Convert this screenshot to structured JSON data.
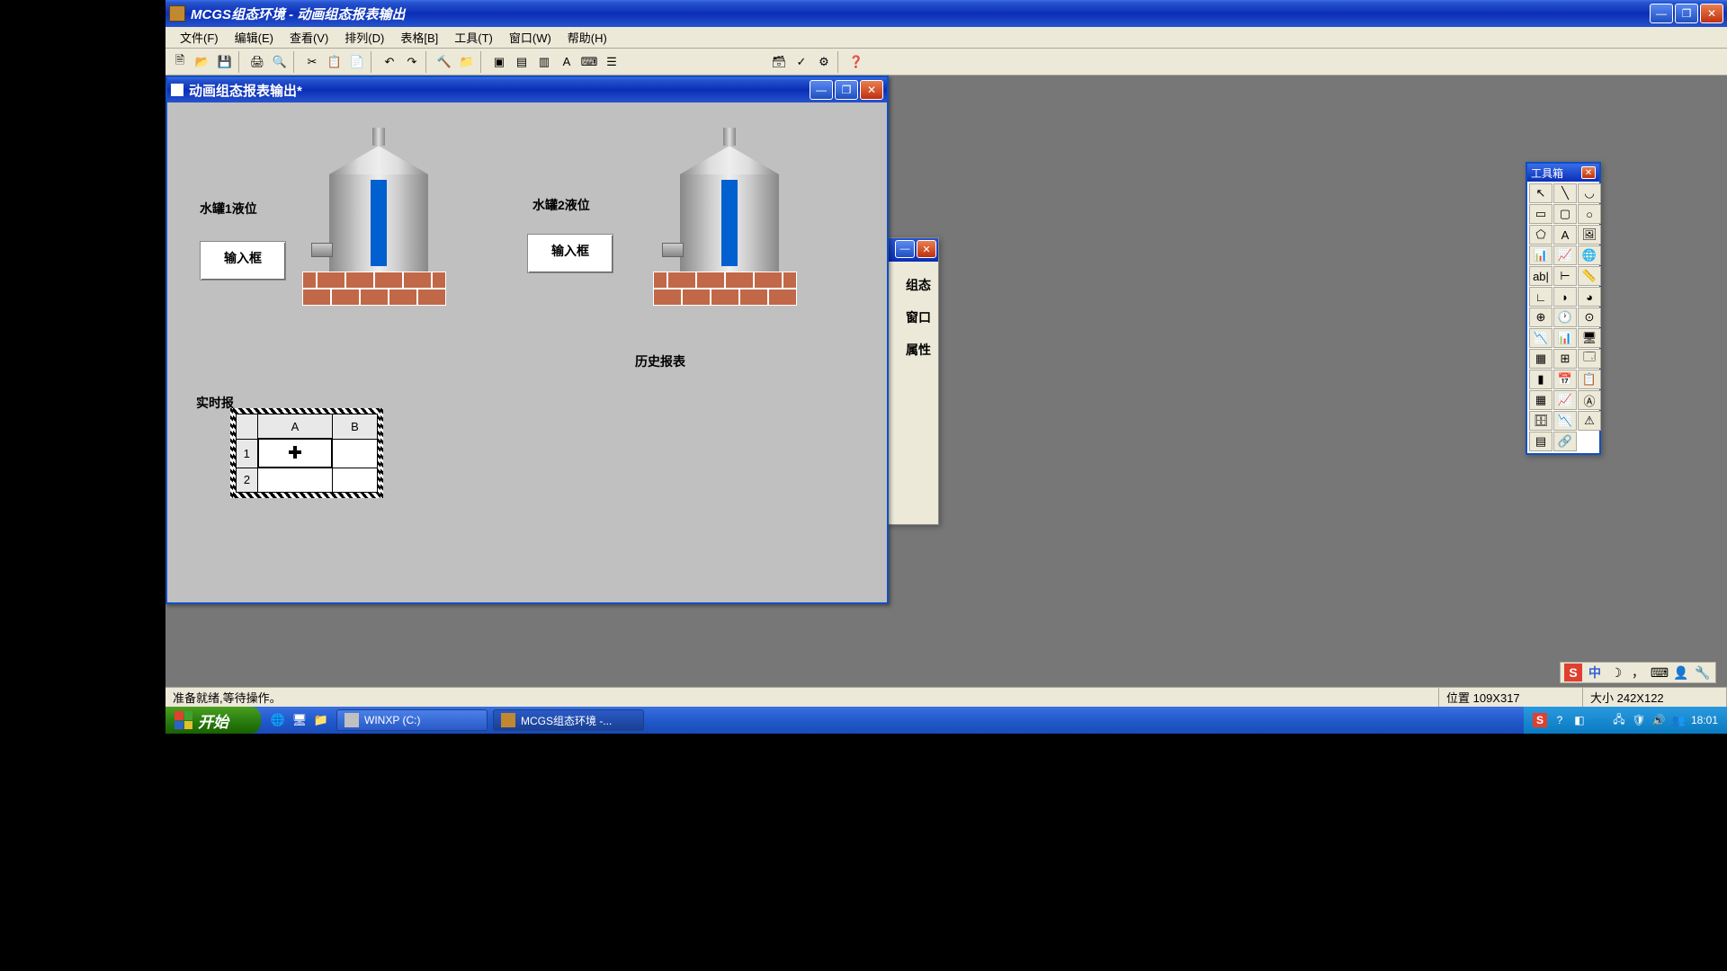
{
  "app": {
    "title": "MCGS组态环境 - 动画组态报表输出"
  },
  "menu": {
    "file": "文件(F)",
    "edit": "编辑(E)",
    "view": "查看(V)",
    "arrange": "排列(D)",
    "table": "表格[B]",
    "tools": "工具(T)",
    "window": "窗口(W)",
    "help": "帮助(H)"
  },
  "child": {
    "title": "动画组态报表输出*"
  },
  "canvas": {
    "tank1_label": "水罐1液位",
    "tank2_label": "水罐2液位",
    "input_box_label": "输入框",
    "history_label": "历史报表",
    "realtime_label": "实时报"
  },
  "grid": {
    "colA": "A",
    "colB": "B",
    "row1": "1",
    "row2": "2"
  },
  "docked": {
    "item1": "组态",
    "item2": "窗口",
    "item3": "属性"
  },
  "toolbox": {
    "title": "工具箱"
  },
  "status": {
    "ready": "准备就绪,等待操作。",
    "pos": "位置 109X317",
    "size": "大小 242X122"
  },
  "taskbar": {
    "start": "开始",
    "task1": "WINXP (C:)",
    "task2": "MCGS组态环境 -...",
    "clock": "18:01"
  },
  "tray_top": {
    "ime": "S",
    "zhong": "中"
  }
}
